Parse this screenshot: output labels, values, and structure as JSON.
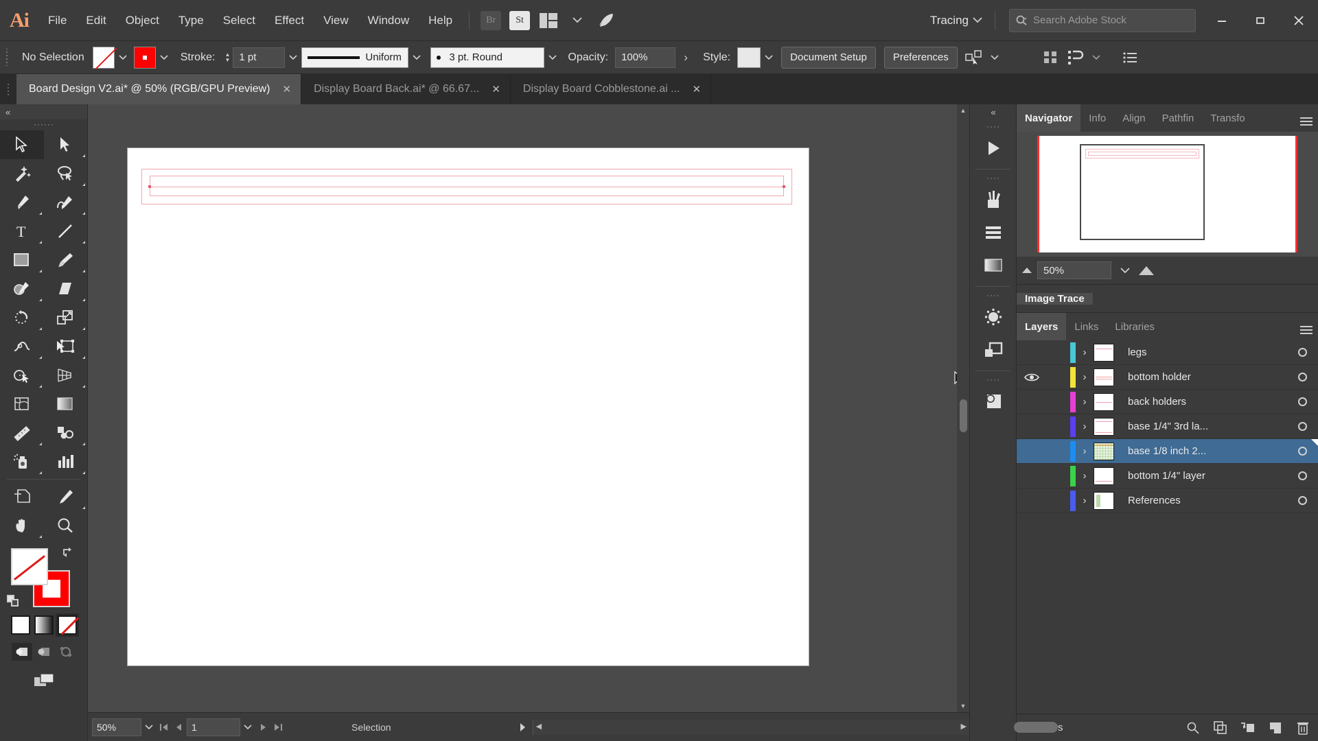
{
  "app": {
    "name": "Adobe Illustrator",
    "logo_text": "Ai"
  },
  "menubar": {
    "items": [
      {
        "label": "File"
      },
      {
        "label": "Edit"
      },
      {
        "label": "Object"
      },
      {
        "label": "Type"
      },
      {
        "label": "Select"
      },
      {
        "label": "Effect"
      },
      {
        "label": "View"
      },
      {
        "label": "Window"
      },
      {
        "label": "Help"
      }
    ],
    "bridge_label": "Br",
    "stock_label": "St",
    "workspace": "Tracing",
    "search_placeholder": "Search Adobe Stock",
    "window_minimize": "–",
    "window_maximize": "❐",
    "window_close": "✕"
  },
  "controlbar": {
    "selection_status": "No Selection",
    "fill_label": "Fill",
    "stroke_swatch_label": "Stroke color",
    "stroke_label": "Stroke:",
    "stroke_weight": "1 pt",
    "stroke_profile": "Uniform",
    "brush_definition": "3 pt. Round",
    "opacity_label": "Opacity:",
    "opacity_value": "100%",
    "opacity_more": "›",
    "style_label": "Style:",
    "document_setup": "Document Setup",
    "preferences": "Preferences"
  },
  "tabs": [
    {
      "title": "Board Design V2.ai* @ 50% (RGB/GPU Preview)",
      "active": true,
      "close": "✕"
    },
    {
      "title": "Display Board Back.ai* @ 66.67...",
      "active": false,
      "close": "✕"
    },
    {
      "title": "Display Board Cobblestone.ai ...",
      "active": false,
      "close": "✕"
    }
  ],
  "toolbar": {
    "collapse": "«",
    "tools": [
      {
        "name": "selection-tool",
        "selected": true
      },
      {
        "name": "direct-selection-tool",
        "selected": false
      },
      {
        "name": "magic-wand-tool",
        "selected": false
      },
      {
        "name": "lasso-tool",
        "selected": false
      },
      {
        "name": "pen-tool",
        "selected": false
      },
      {
        "name": "curvature-tool",
        "selected": false
      },
      {
        "name": "type-tool",
        "selected": false
      },
      {
        "name": "line-segment-tool",
        "selected": false
      },
      {
        "name": "rectangle-tool",
        "selected": false
      },
      {
        "name": "paintbrush-tool",
        "selected": false
      },
      {
        "name": "shaper-tool",
        "selected": false
      },
      {
        "name": "eraser-tool",
        "selected": false
      },
      {
        "name": "rotate-tool",
        "selected": false
      },
      {
        "name": "scale-tool",
        "selected": false
      },
      {
        "name": "width-tool",
        "selected": false
      },
      {
        "name": "free-transform-tool",
        "selected": false
      },
      {
        "name": "shape-builder-tool",
        "selected": false
      },
      {
        "name": "perspective-grid-tool",
        "selected": false
      },
      {
        "name": "mesh-tool",
        "selected": false
      },
      {
        "name": "gradient-tool",
        "selected": false
      },
      {
        "name": "measure-tool",
        "selected": false
      },
      {
        "name": "blend-tool",
        "selected": false
      },
      {
        "name": "symbol-sprayer-tool",
        "selected": false
      },
      {
        "name": "column-graph-tool",
        "selected": false
      },
      {
        "name": "artboard-tool",
        "selected": false
      },
      {
        "name": "slice-tool",
        "selected": false
      },
      {
        "name": "hand-tool",
        "selected": false
      },
      {
        "name": "zoom-tool",
        "selected": false
      }
    ],
    "fill_color": "#ffffff",
    "fill_is_none": true,
    "stroke_color": "#ff0000",
    "draw_modes": [
      "draw-normal",
      "draw-behind",
      "draw-inside"
    ],
    "draw_mode_selected": 0
  },
  "canvas": {
    "artboard_background": "#ffffff",
    "artwork_stroke_color": "#f0a6b0",
    "artwork_description": "Horizontal nested rectangle outlines near top of artboard"
  },
  "statusbar": {
    "zoom_value": "50%",
    "artboard_number": "1",
    "status_text": "Selection",
    "first_glyph": "⏮",
    "prev_glyph": "◀",
    "next_glyph": "▶",
    "last_glyph": "⏭"
  },
  "dockstrip": {
    "icons": [
      {
        "name": "properties-icon"
      },
      {
        "name": "brushes-icon"
      },
      {
        "name": "swatches-icon"
      },
      {
        "name": "gradient-icon"
      },
      {
        "name": "symbols-icon"
      },
      {
        "name": "transparency-icon"
      },
      {
        "name": "pathfinder-icon"
      }
    ]
  },
  "navigator": {
    "tabs": [
      {
        "label": "Navigator",
        "active": true
      },
      {
        "label": "Info",
        "active": false
      },
      {
        "label": "Align",
        "active": false
      },
      {
        "label": "Pathfin",
        "active": false
      },
      {
        "label": "Transfo",
        "active": false
      }
    ],
    "zoom_value": "50%"
  },
  "imagetrace": {
    "tabs": [
      {
        "label": "Image Trace",
        "active": true
      }
    ]
  },
  "layers_panel": {
    "tabs": [
      {
        "label": "Layers",
        "active": true
      },
      {
        "label": "Links",
        "active": false
      },
      {
        "label": "Libraries",
        "active": false
      }
    ],
    "rows": [
      {
        "name": "legs",
        "color": "#49c7d4",
        "visible": false,
        "selected": false,
        "thumb": "lines"
      },
      {
        "name": "bottom holder",
        "color": "#f2e23a",
        "visible": true,
        "selected": false,
        "thumb": "lines"
      },
      {
        "name": "back holders",
        "color": "#e63fd4",
        "visible": false,
        "selected": false,
        "thumb": "lines"
      },
      {
        "name": "base 1/4\" 3rd la...",
        "color": "#5b3ff0",
        "visible": false,
        "selected": false,
        "thumb": "lines"
      },
      {
        "name": "base 1/8 inch 2...",
        "color": "#1e8df0",
        "visible": false,
        "selected": true,
        "thumb": "grid"
      },
      {
        "name": "bottom 1/4\" layer",
        "color": "#3ad24a",
        "visible": false,
        "selected": false,
        "thumb": "lines"
      },
      {
        "name": "References",
        "color": "#4a5bf0",
        "visible": false,
        "selected": false,
        "thumb": "green"
      }
    ],
    "footer_count": "7 Layers",
    "footer_icons": [
      {
        "name": "locate-object-icon"
      },
      {
        "name": "make-clipping-mask-icon"
      },
      {
        "name": "create-new-sublayer-icon"
      },
      {
        "name": "create-new-layer-icon"
      },
      {
        "name": "delete-layer-icon"
      }
    ]
  },
  "colors": {
    "panel_bg": "#3b3b3b",
    "canvas_bg": "#4a4a4a",
    "selection_blue": "#3f6b94",
    "accent_red": "#ff0000"
  }
}
